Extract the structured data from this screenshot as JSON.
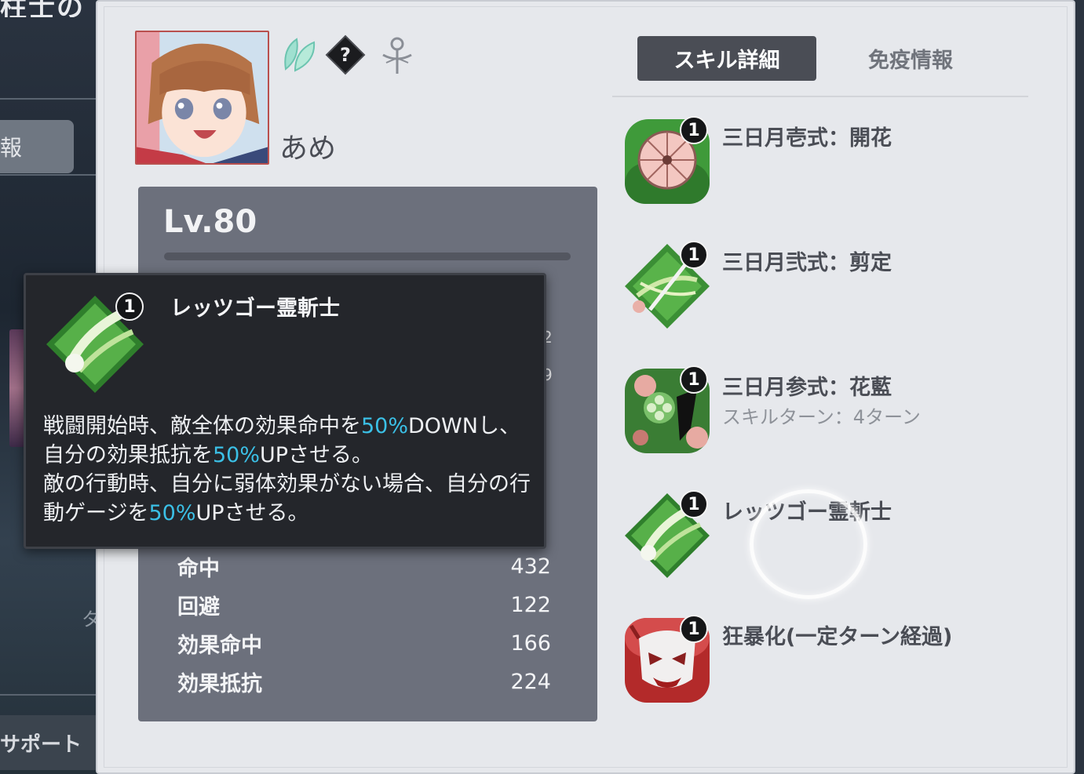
{
  "background": {
    "title_fragment": "柱士の",
    "side_tab_fragment": "報",
    "side_text_fragment": "タ",
    "support_label": "サポート"
  },
  "character": {
    "name": "あめ",
    "attribute_icons": [
      "leaf-element-icon",
      "diamond-class-icon",
      "totem-type-icon"
    ]
  },
  "stats": {
    "level": "Lv.80",
    "rows": [
      {
        "label": "命中",
        "value": "432"
      },
      {
        "label": "回避",
        "value": "122"
      },
      {
        "label": "効果命中",
        "value": "166"
      },
      {
        "label": "効果抵抗",
        "value": "224"
      }
    ]
  },
  "tabs": {
    "skill_detail": "スキル詳細",
    "immunity_info": "免疫情報"
  },
  "skills": [
    {
      "name": "三日月壱式：開花",
      "level": "1",
      "sub": ""
    },
    {
      "name": "三日月弐式：剪定",
      "level": "1",
      "sub": ""
    },
    {
      "name": "三日月参式：花藍",
      "level": "1",
      "sub": "スキルターン：4ターン"
    },
    {
      "name": "レッツゴー霊斬士",
      "level": "1",
      "sub": ""
    },
    {
      "name": "狂暴化(一定ターン経過)",
      "level": "1",
      "sub": ""
    }
  ],
  "tooltip": {
    "skill_name": "レッツゴー霊斬士",
    "level": "1",
    "desc": {
      "p1": "戦闘開始時、敵全体の効果命中を",
      "h1": "50%",
      "p2": "DOWNし、自分の効果抵抗を",
      "h2": "50%",
      "p3": "UPさせる。",
      "p4": "敵の行動時、自分に弱体効果がない場合、自分の行動ゲージを",
      "h3": "50%",
      "p5": "UPさせる。"
    }
  },
  "colors": {
    "highlight": "#3bc0e6",
    "panel_bg": "#e6e8ec",
    "stats_bg": "#6c707c",
    "tooltip_bg": "#24262b",
    "portrait_frame": "#b9504e"
  }
}
